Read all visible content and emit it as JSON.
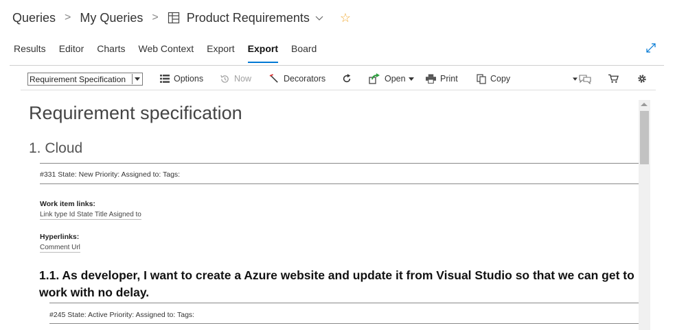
{
  "breadcrumb": {
    "items": [
      "Queries",
      "My Queries",
      "Product Requirements"
    ],
    "separator": ">"
  },
  "tabs": [
    {
      "label": "Results",
      "active": false
    },
    {
      "label": "Editor",
      "active": false
    },
    {
      "label": "Charts",
      "active": false
    },
    {
      "label": "Web Context",
      "active": false
    },
    {
      "label": "Export",
      "active": false
    },
    {
      "label": "Export",
      "active": true
    },
    {
      "label": "Board",
      "active": false
    }
  ],
  "toolbar": {
    "template_select": "Requirement Specification",
    "options_label": "Options",
    "now_label": "Now",
    "decorators_label": "Decorators",
    "open_label": "Open",
    "print_label": "Print",
    "copy_label": "Copy"
  },
  "document": {
    "title": "Requirement specification",
    "section": "1. Cloud",
    "item1_meta": "#331 State: New Priority: Assigned to:  Tags:",
    "links_label": "Work item links:",
    "links_columns": "Link type Id State Title Asigned to",
    "hyperlinks_label": "Hyperlinks:",
    "hyperlinks_columns": "Comment Url",
    "subsection": "1.1. As developer, I want to create a Azure website and update it from Visual Studio so that we can get to work with no delay.",
    "item2_meta": "#245 State: Active Priority: Assigned to:  Tags:"
  },
  "colors": {
    "accent": "#0078d4",
    "star": "#f0a830",
    "open_green": "#2e9e3e"
  }
}
